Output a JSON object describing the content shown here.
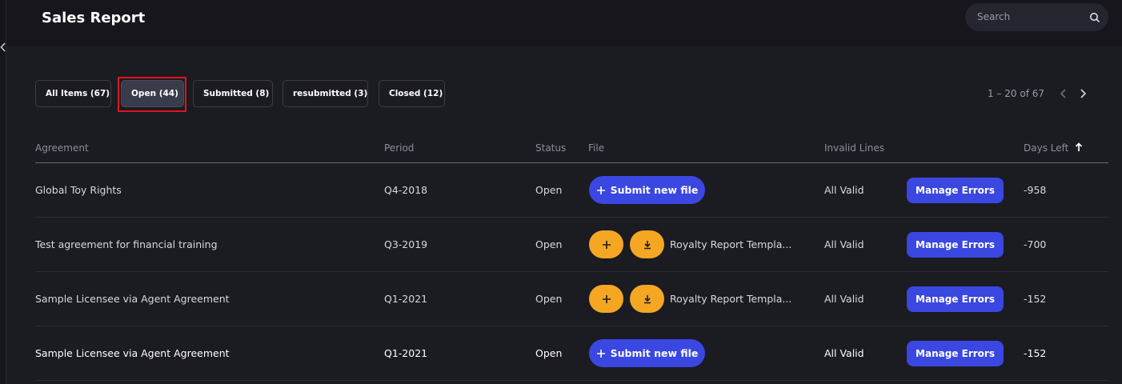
{
  "header": {
    "title": "Sales Report",
    "search_placeholder": "Search"
  },
  "tabs": [
    {
      "label": "All Items (67)"
    },
    {
      "label": "Open (44)",
      "active": true
    },
    {
      "label": "Submitted (8)"
    },
    {
      "label": "resubmitted (3)"
    },
    {
      "label": "Closed (12)"
    }
  ],
  "pagination": {
    "range_text": "1 – 20 of 67"
  },
  "table": {
    "columns": {
      "agreement": "Agreement",
      "period": "Period",
      "status": "Status",
      "file": "File",
      "invalid_lines": "Invalid Lines",
      "days_left": "Days Left"
    },
    "sort_icon": "arrow-up-icon",
    "rows": [
      {
        "agreement": "Global Toy Rights",
        "period": "Q4-2018",
        "status": "Open",
        "file_action": "Submit new file",
        "invalid_lines": "All Valid",
        "manage_label": "Manage Errors",
        "days_left": "-958"
      },
      {
        "agreement": "Test agreement for financial training",
        "period": "Q3-2019",
        "status": "Open",
        "file_name": "Royalty Report Templa...",
        "invalid_lines": "All Valid",
        "manage_label": "Manage Errors",
        "days_left": "-700"
      },
      {
        "agreement": "Sample Licensee via Agent Agreement",
        "period": "Q1-2021",
        "status": "Open",
        "file_name": "Royalty Report Templa...",
        "invalid_lines": "All Valid",
        "manage_label": "Manage Errors",
        "days_left": "-152"
      },
      {
        "agreement": "Sample Licensee via Agent Agreement",
        "period": "Q1-2021",
        "status": "Open",
        "file_action": "Submit new file",
        "invalid_lines": "All Valid",
        "manage_label": "Manage Errors",
        "days_left": "-152"
      }
    ]
  },
  "colors": {
    "background": "#1b1b22",
    "primary_button": "#3a47e0",
    "secondary_button": "#f5a623",
    "highlight": "#e0141e"
  }
}
